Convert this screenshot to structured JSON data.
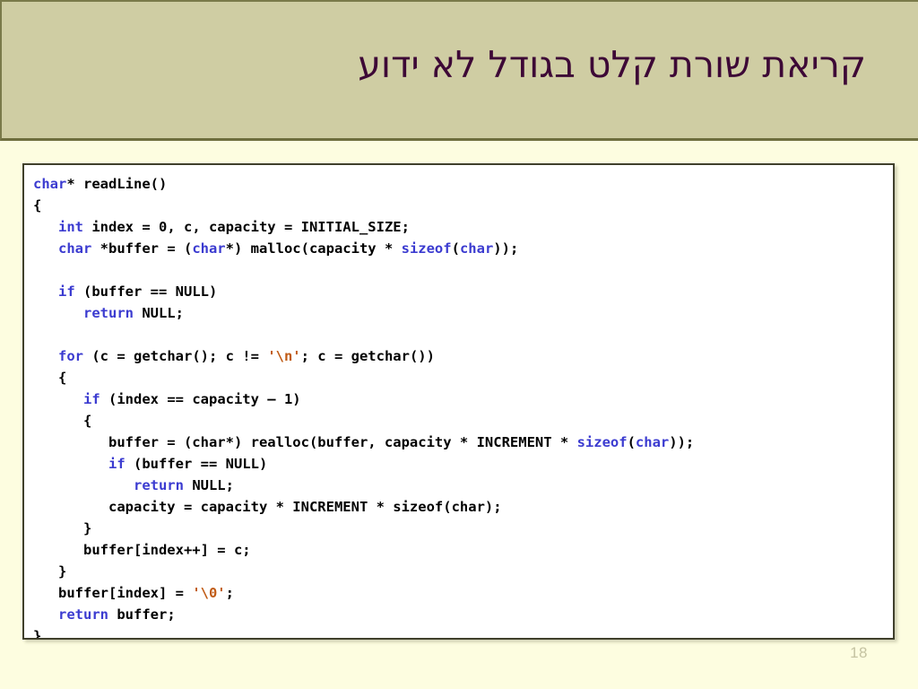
{
  "slide": {
    "title": "קריאת שורת קלט בגודל לא ידוע",
    "page_number": "18",
    "colors": {
      "background": "#fdfde0",
      "title_band": "#cfcda3",
      "title_text": "#3d0836",
      "code_background": "#ffffff",
      "code_border": "#40402c",
      "keyword": "#3b3bd0",
      "string_literal": "#c05a14",
      "plain_text": "#000000",
      "page_number": "#c5c3a2"
    }
  },
  "code": {
    "language": "c",
    "lines": [
      [
        {
          "t": "char",
          "c": "kw"
        },
        {
          "t": "* readLine()",
          "c": "pl"
        }
      ],
      [
        {
          "t": "{",
          "c": "pl"
        }
      ],
      [
        {
          "t": "   ",
          "c": "pl"
        },
        {
          "t": "int",
          "c": "kw"
        },
        {
          "t": " index = 0, c, capacity = INITIAL_SIZE;",
          "c": "pl"
        }
      ],
      [
        {
          "t": "   ",
          "c": "pl"
        },
        {
          "t": "char",
          "c": "kw"
        },
        {
          "t": " *buffer = (",
          "c": "pl"
        },
        {
          "t": "char",
          "c": "kw"
        },
        {
          "t": "*) malloc(capacity * ",
          "c": "pl"
        },
        {
          "t": "sizeof",
          "c": "kw"
        },
        {
          "t": "(",
          "c": "pl"
        },
        {
          "t": "char",
          "c": "kw"
        },
        {
          "t": "));",
          "c": "pl"
        }
      ],
      [],
      [
        {
          "t": "   ",
          "c": "pl"
        },
        {
          "t": "if",
          "c": "kw"
        },
        {
          "t": " (buffer == NULL)",
          "c": "pl"
        }
      ],
      [
        {
          "t": "      ",
          "c": "pl"
        },
        {
          "t": "return",
          "c": "kw"
        },
        {
          "t": " NULL;",
          "c": "pl"
        }
      ],
      [],
      [
        {
          "t": "   ",
          "c": "pl"
        },
        {
          "t": "for",
          "c": "kw"
        },
        {
          "t": " (c = getchar(); c != ",
          "c": "pl"
        },
        {
          "t": "'\\n'",
          "c": "str"
        },
        {
          "t": "; c = getchar())",
          "c": "pl"
        }
      ],
      [
        {
          "t": "   {",
          "c": "pl"
        }
      ],
      [
        {
          "t": "      ",
          "c": "pl"
        },
        {
          "t": "if",
          "c": "kw"
        },
        {
          "t": " (index == capacity – 1)",
          "c": "pl"
        }
      ],
      [
        {
          "t": "      {",
          "c": "pl"
        }
      ],
      [
        {
          "t": "         buffer = (char*) realloc(buffer, capacity * INCREMENT * ",
          "c": "pl"
        },
        {
          "t": "sizeof",
          "c": "kw"
        },
        {
          "t": "(",
          "c": "pl"
        },
        {
          "t": "char",
          "c": "kw"
        },
        {
          "t": "));",
          "c": "pl"
        }
      ],
      [
        {
          "t": "         ",
          "c": "pl"
        },
        {
          "t": "if",
          "c": "kw"
        },
        {
          "t": " (buffer == NULL)",
          "c": "pl"
        }
      ],
      [
        {
          "t": "            ",
          "c": "pl"
        },
        {
          "t": "return",
          "c": "kw"
        },
        {
          "t": " NULL;",
          "c": "pl"
        }
      ],
      [
        {
          "t": "         capacity = capacity * INCREMENT * sizeof(char);",
          "c": "pl"
        }
      ],
      [
        {
          "t": "      }",
          "c": "pl"
        }
      ],
      [
        {
          "t": "      buffer[index++] = c;",
          "c": "pl"
        }
      ],
      [
        {
          "t": "   }",
          "c": "pl"
        }
      ],
      [
        {
          "t": "   buffer[index] = ",
          "c": "pl"
        },
        {
          "t": "'\\0'",
          "c": "str"
        },
        {
          "t": ";",
          "c": "pl"
        }
      ],
      [
        {
          "t": "   ",
          "c": "pl"
        },
        {
          "t": "return",
          "c": "kw"
        },
        {
          "t": " buffer;",
          "c": "pl"
        }
      ],
      [
        {
          "t": "}",
          "c": "pl"
        }
      ]
    ]
  }
}
